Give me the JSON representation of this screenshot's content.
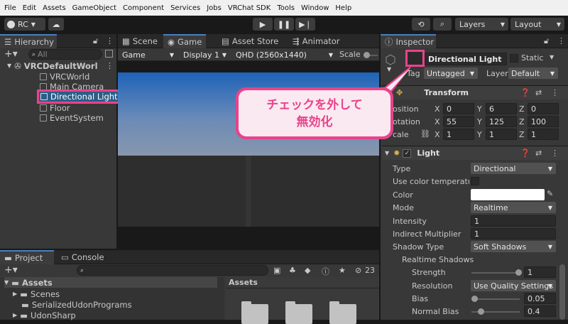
{
  "menu": [
    "File",
    "Edit",
    "Assets",
    "GameObject",
    "Component",
    "Services",
    "Jobs",
    "VRChat SDK",
    "Tools",
    "Window",
    "Help"
  ],
  "toolbar": {
    "account": "RC",
    "layers": "Layers",
    "layout": "Layout"
  },
  "hierarchy": {
    "tab": "Hierarchy",
    "search_placeholder": "All",
    "scene": "VRCDefaultWorl",
    "items": [
      "VRCWorld",
      "Main Camera",
      "Directional Light",
      "Floor",
      "EventSystem"
    ]
  },
  "scene_tabs": [
    "Scene",
    "Game",
    "Asset Store",
    "Animator"
  ],
  "game_toolbar": {
    "mode": "Game",
    "display": "Display 1",
    "resolution": "QHD (2560x1440)",
    "scale": "Scale"
  },
  "callout": {
    "line1": "チェックを外して",
    "line2": "無効化"
  },
  "inspector": {
    "tab": "Inspector",
    "object_name": "Directional Light",
    "static_label": "Static",
    "tag_label": "Tag",
    "tag_value": "Untagged",
    "layer_label": "Layer",
    "layer_value": "Default",
    "transform": {
      "title": "Transform",
      "position_label": "osition",
      "rotation_label": "otation",
      "scale_label": "cale",
      "position": [
        "0",
        "6",
        "0"
      ],
      "rotation": [
        "55",
        "125",
        "100"
      ],
      "scale": [
        "1",
        "1",
        "1"
      ]
    },
    "light": {
      "title": "Light",
      "type_label": "Type",
      "type_value": "Directional",
      "use_color_temp_label": "Use color temperatu",
      "color_label": "Color",
      "mode_label": "Mode",
      "mode_value": "Realtime",
      "intensity_label": "Intensity",
      "intensity_value": "1",
      "indirect_label": "Indirect Multiplier",
      "indirect_value": "1",
      "shadow_type_label": "Shadow Type",
      "shadow_type_value": "Soft Shadows",
      "realtime_shadows_label": "Realtime Shadows",
      "strength_label": "Strength",
      "strength_value": "1",
      "resolution_label": "Resolution",
      "resolution_value": "Use Quality Settings",
      "bias_label": "Bias",
      "bias_value": "0.05",
      "normal_bias_label": "Normal Bias",
      "normal_bias_value": "0.4"
    }
  },
  "project": {
    "tabs": [
      "Project",
      "Console"
    ],
    "count": "23",
    "tree": [
      "Assets",
      "Scenes",
      "SerializedUdonPrograms",
      "UdonSharp"
    ],
    "assets_header": "Assets"
  },
  "colors": {
    "accent": "#e8438b",
    "selection": "#2c5d87",
    "bg": "#383838",
    "header": "#282828"
  }
}
